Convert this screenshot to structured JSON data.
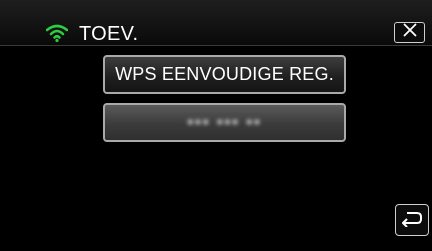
{
  "header": {
    "title": "TOEV.",
    "icon": "wifi-icon",
    "icon_color": "#2ecc40"
  },
  "buttons": {
    "wps_label": "WPS EENVOUDIGE REG.",
    "network_label": "▪▪▪ ▪▪▪ ▪▪"
  },
  "controls": {
    "close_icon": "close-icon",
    "back_icon": "back-icon"
  }
}
